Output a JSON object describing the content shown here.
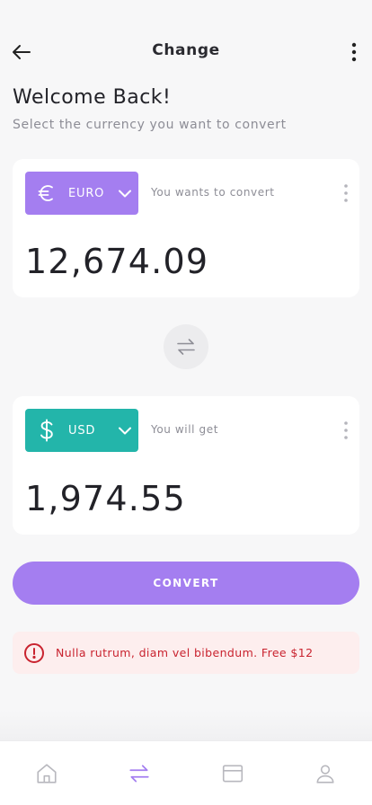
{
  "header": {
    "title": "Change"
  },
  "welcome": {
    "title": "Welcome Back!",
    "subtitle": "Select the currency you want to convert"
  },
  "from": {
    "currency": "EURO",
    "caption": "You wants to convert",
    "amount": "12,674.09",
    "color": "#a47ef0",
    "icon": "euro-icon"
  },
  "to": {
    "currency": "USD",
    "caption": "You will get",
    "amount": "1,974.55",
    "color": "#23b5aa",
    "icon": "dollar-icon"
  },
  "convert": {
    "label": "CONVERT"
  },
  "alert": {
    "text": "Nulla rutrum, diam vel bibendum. Free $12",
    "color": "#c9232f"
  },
  "nav": {
    "items": [
      "home-icon",
      "swap-icon",
      "card-icon",
      "user-icon"
    ],
    "active": "swap-icon",
    "active_color": "#a47ef0"
  }
}
